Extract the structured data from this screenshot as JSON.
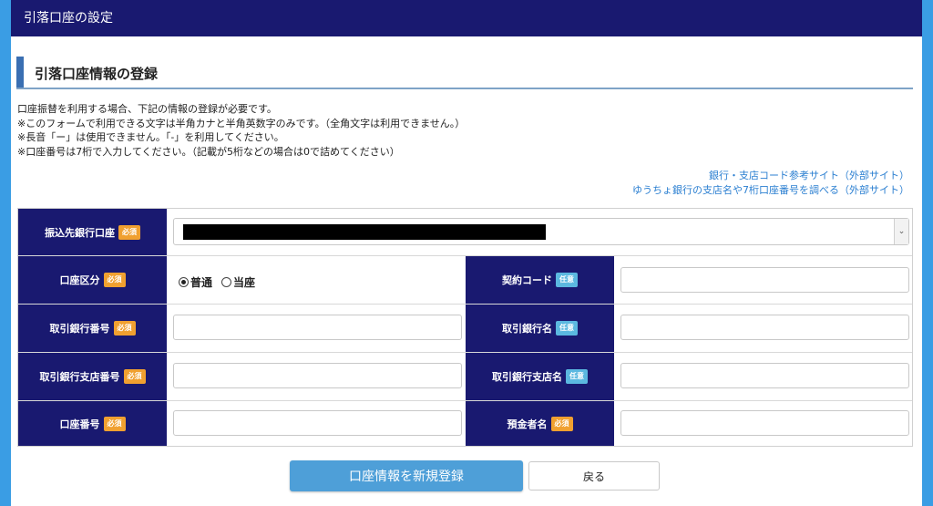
{
  "header": {
    "title": "引落口座の設定"
  },
  "section": {
    "title": "引落口座情報の登録"
  },
  "notes": [
    "口座振替を利用する場合、下記の情報の登録が必要です。",
    "※このフォームで利用できる文字は半角カナと半角英数字のみです。（全角文字は利用できません。）",
    "※長音「ー」は使用できません。「-」を利用してください。",
    "※口座番号は7桁で入力してください。（記載が5桁などの場合は0で詰めてください）"
  ],
  "links": [
    "銀行・支店コード参考サイト（外部サイト）",
    "ゆうちょ銀行の支店名や7桁口座番号を調べる（外部サイト）"
  ],
  "badges": {
    "required": "必須",
    "optional": "任意"
  },
  "form": {
    "bank_account_label": "振込先銀行口座",
    "account_type_label": "口座区分",
    "account_type_options": [
      "普通",
      "当座"
    ],
    "account_type_selected": "普通",
    "contract_code_label": "契約コード",
    "bank_code_label": "取引銀行番号",
    "bank_name_label": "取引銀行名",
    "branch_code_label": "取引銀行支店番号",
    "branch_name_label": "取引銀行支店名",
    "account_number_label": "口座番号",
    "account_holder_label": "預金者名"
  },
  "buttons": {
    "register": "口座情報を新規登録",
    "back": "戻る"
  },
  "colors": {
    "header": "#191970",
    "label_bg": "#191970",
    "required": "#f0a030",
    "optional": "#5bb8e0",
    "primary": "#4e9fd8",
    "link": "#2b7fd1"
  }
}
